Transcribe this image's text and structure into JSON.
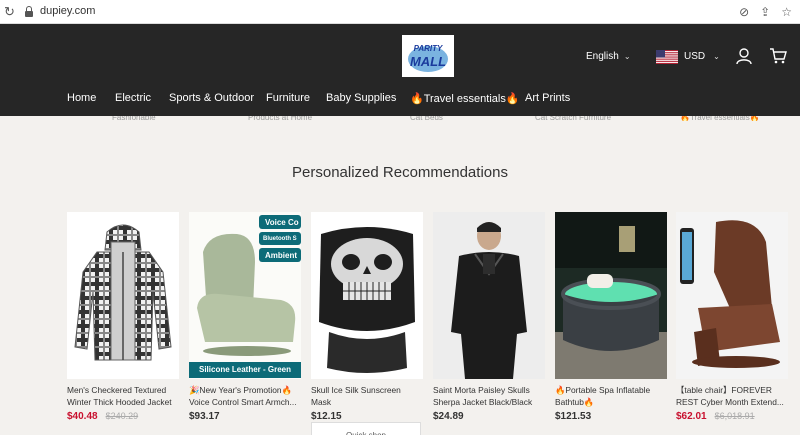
{
  "browser": {
    "url": "dupiey.com",
    "reload_icon": "reload-icon",
    "lock_icon": "lock-icon"
  },
  "header": {
    "logo_line1": "PARITY",
    "logo_line2": "MALL",
    "language": "English",
    "currency": "USD",
    "bg_color": "#262626"
  },
  "nav": {
    "items": [
      {
        "label": "Home"
      },
      {
        "label": "Electric"
      },
      {
        "label": "Sports & Outdoor"
      },
      {
        "label": "Furniture"
      },
      {
        "label": "Baby Supplies"
      },
      {
        "label": "🔥Travel essentials🔥"
      },
      {
        "label": "Art Prints"
      }
    ]
  },
  "partial_row": [
    "Fashionable",
    "Products at Home",
    "Cat Beds",
    "Cat Scratch Furniture",
    "🔥Travel essentials🔥"
  ],
  "section": {
    "title": "Personalized Recommendations"
  },
  "products": [
    {
      "title": "Men's Checkered Textured Winter Thick Hooded Jacket",
      "price": "$40.48",
      "old_price": "$240.29",
      "sale": true
    },
    {
      "title": "🎉New Year's Promotion🔥 Voice Control Smart Armch...",
      "price": "$93.17",
      "old_price": "",
      "sale": false,
      "badges": [
        "Voice Co",
        "Bluetooth S",
        "Ambient"
      ],
      "banner": "Silicone Leather - Green"
    },
    {
      "title": "Skull Ice Silk Sunscreen Mask",
      "price": "$12.15",
      "old_price": "",
      "sale": false
    },
    {
      "title": "Saint Morta Paisley Skulls Sherpa Jacket Black/Black",
      "price": "$24.89",
      "old_price": "",
      "sale": false
    },
    {
      "title": "🔥Portable Spa Inflatable Bathtub🔥",
      "price": "$121.53",
      "old_price": "",
      "sale": false
    },
    {
      "title": "【table chair】FOREVER REST Cyber Month Extend...",
      "price": "$62.01",
      "old_price": "$6,018.91",
      "sale": true
    }
  ],
  "quick_shop": "Quick shop",
  "colors": {
    "sale_price": "#c8102e",
    "page_bg": "#f3f1ee"
  }
}
